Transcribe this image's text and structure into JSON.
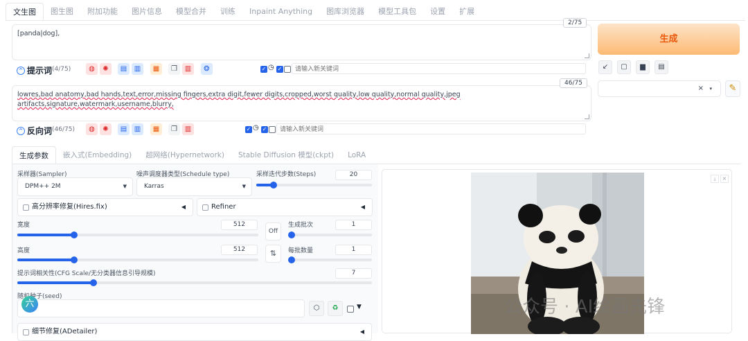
{
  "top_tabs": [
    "文生图",
    "图生图",
    "附加功能",
    "图片信息",
    "模型合并",
    "训练",
    "Inpaint Anything",
    "图库浏览器",
    "模型工具包",
    "设置",
    "扩展"
  ],
  "prompt": {
    "text": "[panda|dog],",
    "counter": "2/75",
    "label": "提示词",
    "count": "(4/75)",
    "keyword_placeholder": "请输入新关键词"
  },
  "negative": {
    "text": "lowres,bad anatomy,bad hands,text,error,missing fingers,extra digit,fewer digits,cropped,worst quality,low quality,normal quality,jpeg artifacts,signature,watermark,username,blurry,",
    "counter": "46/75",
    "label": "反向词",
    "count": "(46/75)",
    "keyword_placeholder": "请输入新关键词"
  },
  "generate_label": "生成",
  "sub_tabs": [
    "生成参数",
    "嵌入式(Embedding)",
    "超网络(Hypernetwork)",
    "Stable Diffusion 模型(ckpt)",
    "LoRA"
  ],
  "params": {
    "sampler_label": "采样器(Sampler)",
    "sampler_value": "DPM++ 2M",
    "schedule_label": "噪声调度器类型(Schedule type)",
    "schedule_value": "Karras",
    "steps_label": "采样迭代步数(Steps)",
    "steps_value": "20",
    "hires_label": "高分辨率修复(Hires.fix)",
    "refiner_label": "Refiner",
    "width_label": "宽度",
    "width_value": "512",
    "height_label": "高度",
    "height_value": "512",
    "off_label": "Off",
    "swap_icon": "⇅",
    "batch_count_label": "生成批次",
    "batch_count_value": "1",
    "batch_size_label": "每批数量",
    "batch_size_value": "1",
    "cfg_label": "提示词相关性(CFG Scale/无分类器信息引导规模)",
    "cfg_value": "7",
    "seed_label": "随机种子(seed)",
    "seed_avatar": "六",
    "adetailer_label": "细节修复(ADetailer)"
  },
  "watermark": "公众号 · AI绘画先锋",
  "icons": [
    "collapse-icon",
    "globe-icon",
    "gear-icon",
    "paste-icon",
    "bookmark-icon",
    "grid-icon",
    "copy-icon",
    "trash-icon",
    "settings-icon",
    "arrow-icon",
    "square-icon",
    "clipboard-icon",
    "pencil-icon",
    "dice-icon",
    "recycle-icon",
    "download-icon",
    "close-icon"
  ],
  "colors": {
    "accent": "#2563eb",
    "generate": "#ea580c"
  }
}
